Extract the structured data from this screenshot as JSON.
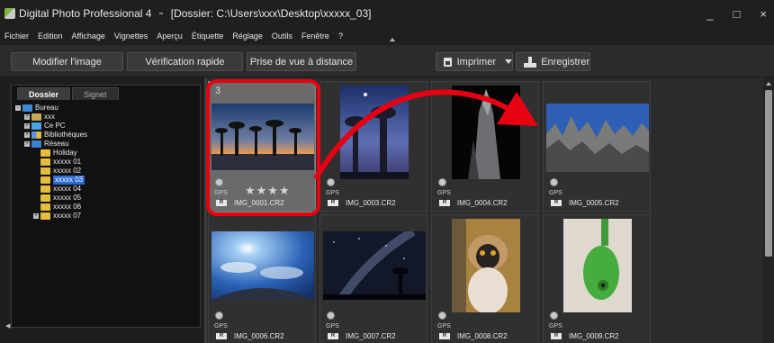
{
  "window": {
    "app_title": "Digital Photo Professional 4",
    "folder_title": "[Dossier: C:\\Users\\xxx\\Desktop\\xxxxx_03]",
    "controls": {
      "minimize": "_",
      "maximize": "□",
      "close": "×"
    }
  },
  "menu": {
    "items": [
      "Fichier",
      "Edition",
      "Affichage",
      "Vignettes",
      "Aperçu",
      "Étiquette",
      "Réglage",
      "Outils",
      "Fenêtre",
      "?"
    ]
  },
  "toolbar": {
    "edit_image": "Modifier l'image",
    "quick_check": "Vérification rapide",
    "remote_shooting": "Prise de vue à distance",
    "print": "Imprimer",
    "save": "Enregistrer"
  },
  "sidebar": {
    "tabs": [
      "Dossier",
      "Signet"
    ],
    "active_tab": "Dossier",
    "tree": [
      {
        "label": "Bureau",
        "level": 0,
        "icon": "desktop-icon",
        "expander": "-"
      },
      {
        "label": "xxx",
        "level": 1,
        "icon": "user-folder-icon",
        "expander": "+"
      },
      {
        "label": "Ce PC",
        "level": 1,
        "icon": "computer-icon",
        "expander": "+"
      },
      {
        "label": "Bibliothèques",
        "level": 1,
        "icon": "library-icon",
        "expander": "+"
      },
      {
        "label": "Réseau",
        "level": 1,
        "icon": "network-icon",
        "expander": "+"
      },
      {
        "label": "Holiday",
        "level": 2,
        "icon": "folder-icon",
        "expander": ""
      },
      {
        "label": "xxxxx 01",
        "level": 2,
        "icon": "folder-icon",
        "expander": ""
      },
      {
        "label": "xxxxx 02",
        "level": 2,
        "icon": "folder-icon",
        "expander": ""
      },
      {
        "label": "xxxxx 03",
        "level": 2,
        "icon": "folder-icon",
        "expander": "",
        "selected": true
      },
      {
        "label": "xxxxx 04",
        "level": 2,
        "icon": "folder-icon",
        "expander": ""
      },
      {
        "label": "xxxxx 05",
        "level": 2,
        "icon": "folder-icon",
        "expander": ""
      },
      {
        "label": "xxxxx 06",
        "level": 2,
        "icon": "folder-icon",
        "expander": ""
      },
      {
        "label": "xxxxx 07",
        "level": 2,
        "icon": "folder-icon",
        "expander": "+"
      }
    ]
  },
  "thumbnails": [
    {
      "filename": "IMG_0001.CR2",
      "gps": "GPS",
      "raw": "R",
      "stars": "★★★★",
      "stack": "3",
      "scene": "baobab-sunset",
      "selected": true
    },
    {
      "filename": "IMG_0003.CR2",
      "gps": "GPS",
      "raw": "R",
      "scene": "baobab-night"
    },
    {
      "filename": "IMG_0004.CR2",
      "gps": "GPS",
      "raw": "R",
      "scene": "rock-spire"
    },
    {
      "filename": "IMG_0005.CR2",
      "gps": "GPS",
      "raw": "R",
      "scene": "tsingy-rocks"
    },
    {
      "filename": "IMG_0006.CR2",
      "gps": "GPS",
      "raw": "R",
      "scene": "sky-fisheye"
    },
    {
      "filename": "IMG_0007.CR2",
      "gps": "GPS",
      "raw": "R",
      "scene": "milky-way"
    },
    {
      "filename": "IMG_0008.CR2",
      "gps": "GPS",
      "raw": "R",
      "scene": "lemur"
    },
    {
      "filename": "IMG_0009.CR2",
      "gps": "GPS",
      "raw": "R",
      "scene": "chameleon"
    }
  ],
  "colors": {
    "highlight": "#e60012",
    "arrow": "#e60012",
    "selection": "#2b6ad3"
  }
}
